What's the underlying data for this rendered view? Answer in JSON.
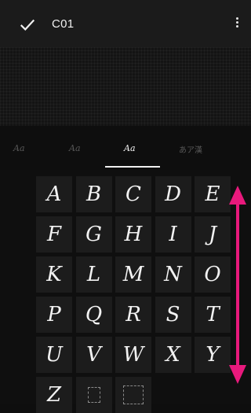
{
  "header": {
    "title": "C01",
    "check_icon": "check-icon",
    "menu_icon": "more-vert-icon"
  },
  "tabs": [
    {
      "label": "Aa",
      "active": false
    },
    {
      "label": "Aa",
      "active": false
    },
    {
      "label": "Aa",
      "active": true
    },
    {
      "label": "あア漢",
      "active": false
    }
  ],
  "keys": [
    "A",
    "B",
    "C",
    "D",
    "E",
    "F",
    "G",
    "H",
    "I",
    "J",
    "K",
    "L",
    "M",
    "N",
    "O",
    "P",
    "Q",
    "R",
    "S",
    "T",
    "U",
    "V",
    "W",
    "X",
    "Y",
    "Z"
  ],
  "placeholders": 2,
  "colors": {
    "background": "#0e0e0e",
    "key_background": "#1c1c1c",
    "accent_arrow": "#e8197c"
  }
}
